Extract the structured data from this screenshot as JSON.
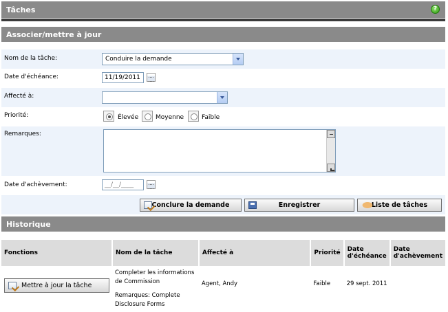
{
  "window": {
    "title": "Tâches",
    "help_icon": "help-icon"
  },
  "section_assign": {
    "title": "Associer/mettre à jour"
  },
  "form": {
    "task_name": {
      "label": "Nom de la tâche:",
      "value": "Conduire la demande"
    },
    "due_date": {
      "label": "Date d'échéance:",
      "value": "11/19/2011"
    },
    "assigned_to": {
      "label": "Affecté à:",
      "value": ""
    },
    "priority": {
      "label": "Priorité:",
      "options": [
        "Élevée",
        "Moyenne",
        "Faible"
      ],
      "selected": "Élevée"
    },
    "remarks": {
      "label": "Remarques:",
      "value": ""
    },
    "completion_date": {
      "label": "Date d'achèvement:",
      "value": "__/__/____"
    }
  },
  "actions": {
    "conclude_label": "Conclure la demande",
    "save_label": "Enregistrer",
    "list_label": "Liste de tâches"
  },
  "section_history": {
    "title": "Historique"
  },
  "history": {
    "columns": [
      "Fonctions",
      "Nom de la tâche",
      "Affecté à",
      "Priorité",
      "Date d'échéance",
      "Date d'achèvement"
    ],
    "rows": [
      {
        "action_label": "Mettre à jour la tâche",
        "task_name": "Completer les informations de Commission",
        "remarks": "Remarques: Complete Disclosure Forms",
        "assigned_to": "Agent, Andy",
        "priority": "Faible",
        "due_date": "29 sept. 2011",
        "completion_date": ""
      }
    ]
  }
}
